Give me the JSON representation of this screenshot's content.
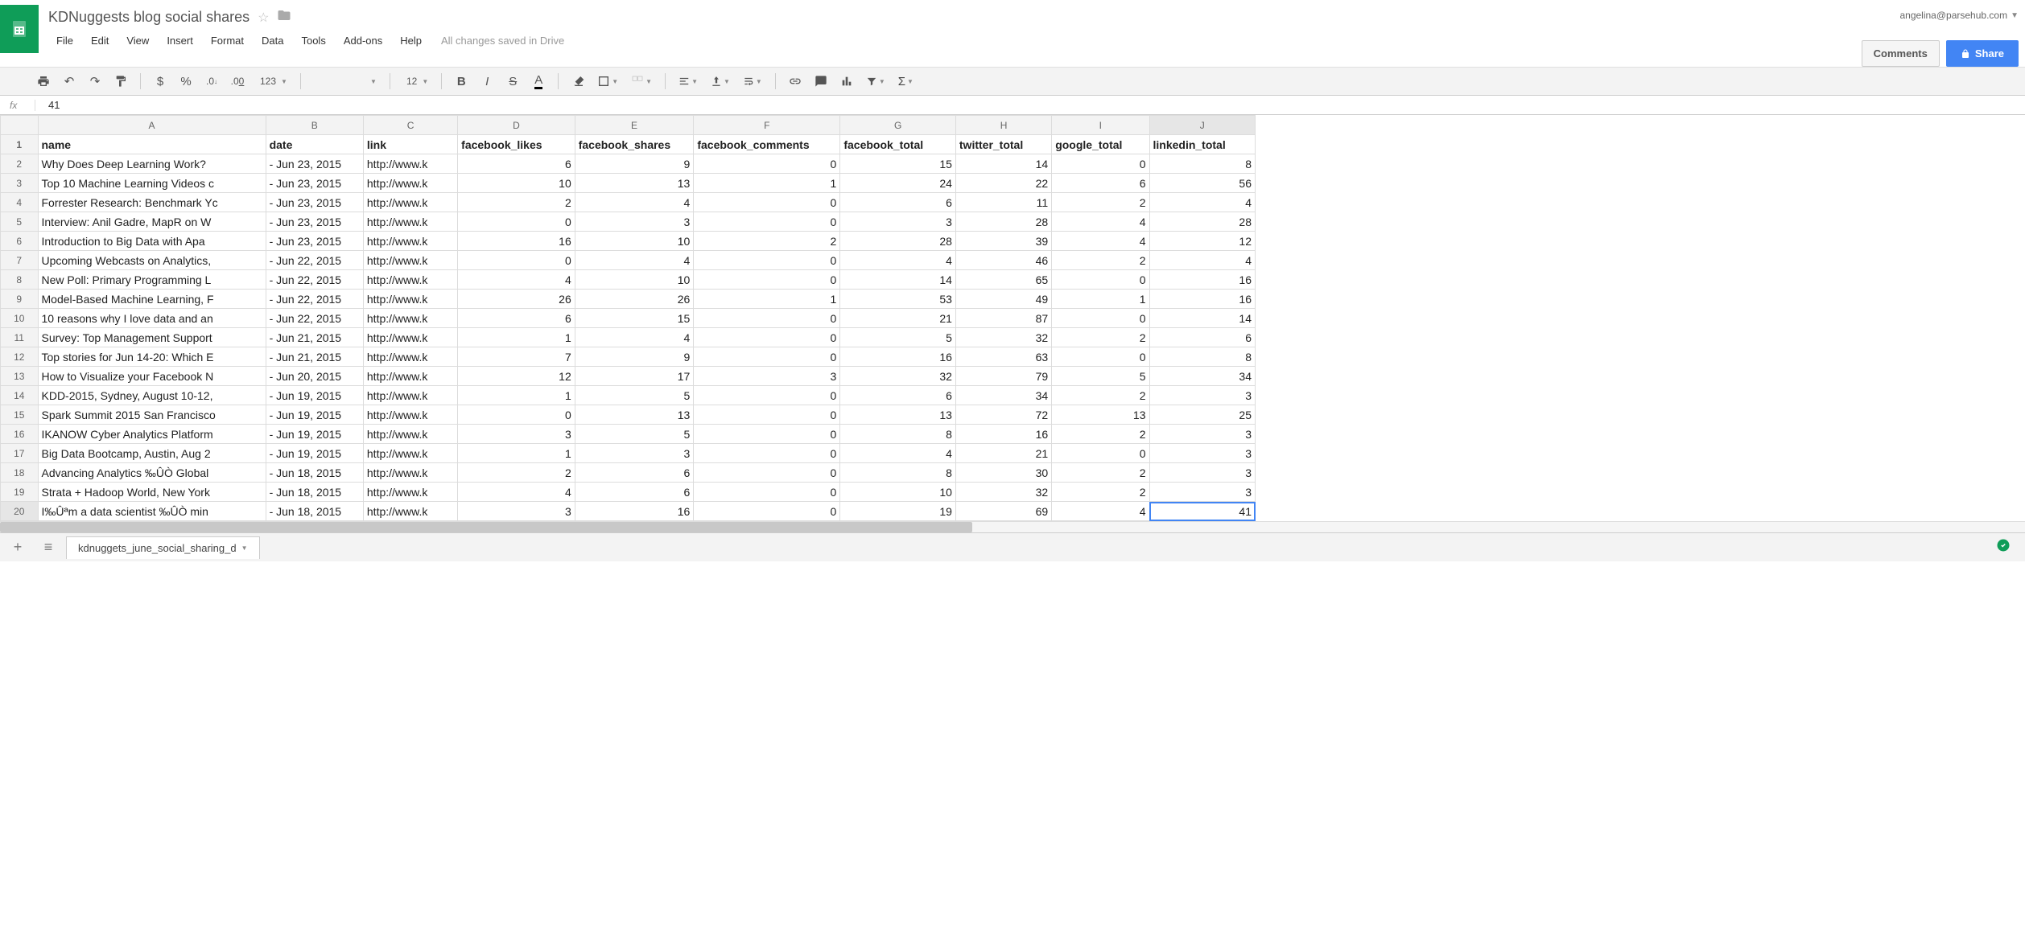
{
  "doc": {
    "title": "KDNuggests blog social shares",
    "user_email": "angelina@parsehub.com",
    "save_status": "All changes saved in Drive",
    "comments_label": "Comments",
    "share_label": "Share"
  },
  "menu": [
    "File",
    "Edit",
    "View",
    "Insert",
    "Format",
    "Data",
    "Tools",
    "Add-ons",
    "Help"
  ],
  "toolbar": {
    "currency": "$",
    "percent": "%",
    "dec_dec": ".0←",
    "dec_inc": ".00→",
    "numfmt": "123",
    "font_size": "12"
  },
  "formula": {
    "fx": "fx",
    "value": "41"
  },
  "columns": [
    "A",
    "B",
    "C",
    "D",
    "E",
    "F",
    "G",
    "H",
    "I",
    "J"
  ],
  "headers": [
    "name",
    "date",
    "link",
    "facebook_likes",
    "facebook_shares",
    "facebook_comments",
    "facebook_total",
    "twitter_total",
    "google_total",
    "linkedin_total"
  ],
  "rows": [
    {
      "name": "Why Does Deep Learning Work?",
      "date": "- Jun 23, 2015",
      "link": "http://www.k",
      "fl": 6,
      "fs": 9,
      "fc": 0,
      "ft": 15,
      "tt": 14,
      "gt": 0,
      "lt": 8
    },
    {
      "name": "Top 10 Machine Learning Videos c",
      "date": "- Jun 23, 2015",
      "link": "http://www.k",
      "fl": 10,
      "fs": 13,
      "fc": 1,
      "ft": 24,
      "tt": 22,
      "gt": 6,
      "lt": 56
    },
    {
      "name": "Forrester Research: Benchmark Yc",
      "date": "- Jun 23, 2015",
      "link": "http://www.k",
      "fl": 2,
      "fs": 4,
      "fc": 0,
      "ft": 6,
      "tt": 11,
      "gt": 2,
      "lt": 4
    },
    {
      "name": "Interview: Anil Gadre, MapR on W",
      "date": "- Jun 23, 2015",
      "link": "http://www.k",
      "fl": 0,
      "fs": 3,
      "fc": 0,
      "ft": 3,
      "tt": 28,
      "gt": 4,
      "lt": 28
    },
    {
      "name": "Introduction to Big Data with Apa",
      "date": "- Jun 23, 2015",
      "link": "http://www.k",
      "fl": 16,
      "fs": 10,
      "fc": 2,
      "ft": 28,
      "tt": 39,
      "gt": 4,
      "lt": 12
    },
    {
      "name": "Upcoming Webcasts on Analytics,",
      "date": "- Jun 22, 2015",
      "link": "http://www.k",
      "fl": 0,
      "fs": 4,
      "fc": 0,
      "ft": 4,
      "tt": 46,
      "gt": 2,
      "lt": 4
    },
    {
      "name": "New Poll: Primary Programming L",
      "date": "- Jun 22, 2015",
      "link": "http://www.k",
      "fl": 4,
      "fs": 10,
      "fc": 0,
      "ft": 14,
      "tt": 65,
      "gt": 0,
      "lt": 16
    },
    {
      "name": "Model-Based Machine Learning, F",
      "date": "- Jun 22, 2015",
      "link": "http://www.k",
      "fl": 26,
      "fs": 26,
      "fc": 1,
      "ft": 53,
      "tt": 49,
      "gt": 1,
      "lt": 16
    },
    {
      "name": "10 reasons why I love data and an",
      "date": "- Jun 22, 2015",
      "link": "http://www.k",
      "fl": 6,
      "fs": 15,
      "fc": 0,
      "ft": 21,
      "tt": 87,
      "gt": 0,
      "lt": 14
    },
    {
      "name": "Survey: Top Management Support",
      "date": "- Jun 21, 2015",
      "link": "http://www.k",
      "fl": 1,
      "fs": 4,
      "fc": 0,
      "ft": 5,
      "tt": 32,
      "gt": 2,
      "lt": 6
    },
    {
      "name": "Top stories for Jun 14-20: Which E",
      "date": "- Jun 21, 2015",
      "link": "http://www.k",
      "fl": 7,
      "fs": 9,
      "fc": 0,
      "ft": 16,
      "tt": 63,
      "gt": 0,
      "lt": 8
    },
    {
      "name": "How to Visualize your Facebook N",
      "date": "- Jun 20, 2015",
      "link": "http://www.k",
      "fl": 12,
      "fs": 17,
      "fc": 3,
      "ft": 32,
      "tt": 79,
      "gt": 5,
      "lt": 34
    },
    {
      "name": "KDD-2015, Sydney, August 10-12,",
      "date": "- Jun 19, 2015",
      "link": "http://www.k",
      "fl": 1,
      "fs": 5,
      "fc": 0,
      "ft": 6,
      "tt": 34,
      "gt": 2,
      "lt": 3
    },
    {
      "name": "Spark Summit 2015 San Francisco",
      "date": "- Jun 19, 2015",
      "link": "http://www.k",
      "fl": 0,
      "fs": 13,
      "fc": 0,
      "ft": 13,
      "tt": 72,
      "gt": 13,
      "lt": 25
    },
    {
      "name": "IKANOW Cyber Analytics Platform",
      "date": "- Jun 19, 2015",
      "link": "http://www.k",
      "fl": 3,
      "fs": 5,
      "fc": 0,
      "ft": 8,
      "tt": 16,
      "gt": 2,
      "lt": 3
    },
    {
      "name": "Big Data Bootcamp, Austin, Aug 2",
      "date": "- Jun 19, 2015",
      "link": "http://www.k",
      "fl": 1,
      "fs": 3,
      "fc": 0,
      "ft": 4,
      "tt": 21,
      "gt": 0,
      "lt": 3
    },
    {
      "name": "Advancing Analytics ‰ÛÒ Global",
      "date": "- Jun 18, 2015",
      "link": "http://www.k",
      "fl": 2,
      "fs": 6,
      "fc": 0,
      "ft": 8,
      "tt": 30,
      "gt": 2,
      "lt": 3
    },
    {
      "name": "Strata + Hadoop World, New York",
      "date": "- Jun 18, 2015",
      "link": "http://www.k",
      "fl": 4,
      "fs": 6,
      "fc": 0,
      "ft": 10,
      "tt": 32,
      "gt": 2,
      "lt": 3
    },
    {
      "name": "I‰Ûªm a data scientist ‰ÛÒ min",
      "date": "- Jun 18, 2015",
      "link": "http://www.k",
      "fl": 3,
      "fs": 16,
      "fc": 0,
      "ft": 19,
      "tt": 69,
      "gt": 4,
      "lt": 41
    }
  ],
  "selected": {
    "col": "J",
    "row": 20
  },
  "tab": {
    "name": "kdnuggets_june_social_sharing_d"
  }
}
